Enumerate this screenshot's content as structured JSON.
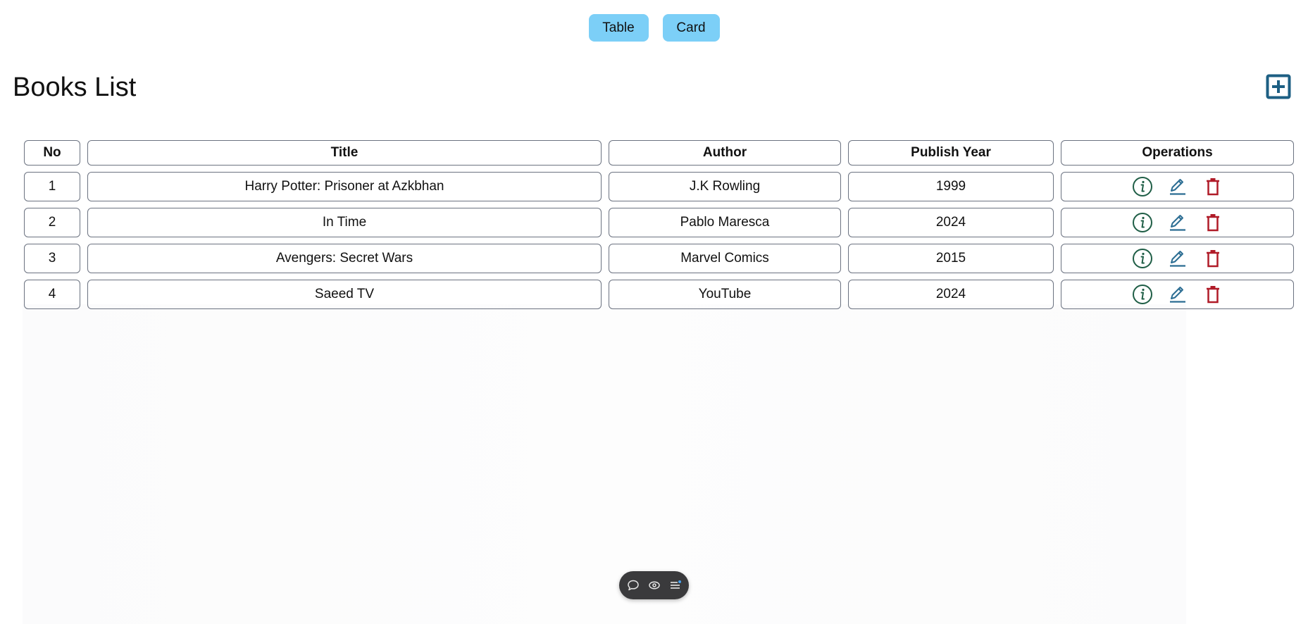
{
  "view_switch": {
    "table_label": "Table",
    "card_label": "Card"
  },
  "page": {
    "title": "Books List",
    "add_icon": "plus-box-icon"
  },
  "table": {
    "headers": {
      "no": "No",
      "title": "Title",
      "author": "Author",
      "year": "Publish Year",
      "operations": "Operations"
    },
    "rows": [
      {
        "no": "1",
        "title": "Harry Potter: Prisoner at Azkbhan",
        "author": "J.K Rowling",
        "year": "1999"
      },
      {
        "no": "2",
        "title": "In Time",
        "author": "Pablo Maresca",
        "year": "2024"
      },
      {
        "no": "3",
        "title": "Avengers: Secret Wars",
        "author": "Marvel Comics",
        "year": "2015"
      },
      {
        "no": "4",
        "title": "Saeed TV",
        "author": "YouTube",
        "year": "2024"
      }
    ],
    "operation_icons": [
      "info-icon",
      "edit-icon",
      "trash-icon"
    ]
  },
  "colors": {
    "view_button": "#7ccff7",
    "add_icon": "#1d5f83",
    "info_icon": "#1f5e46",
    "edit_icon": "#2a6c92",
    "delete_icon": "#b01b28",
    "toolbar_bg": "#3a3a3c",
    "toolbar_dot": "#4aa3f0"
  },
  "toolbar": {
    "icons": [
      "comment-icon",
      "eye-icon",
      "menu-icon"
    ]
  }
}
